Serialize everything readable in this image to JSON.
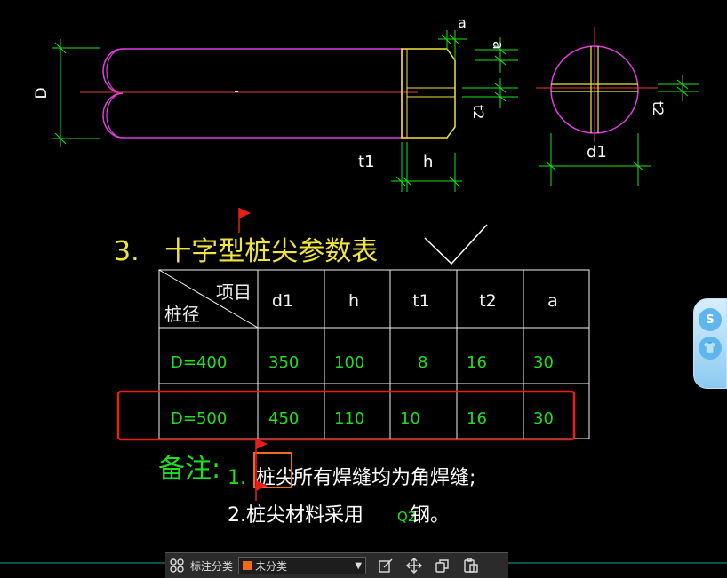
{
  "dimension_labels": {
    "D": "D",
    "a_top": "a",
    "a_side": "a",
    "t2_left": "t2",
    "t1": "t1",
    "h": "h",
    "d1": "d1",
    "t2_right": "t2"
  },
  "table_title": "3.   十字型桩尖参数表",
  "table": {
    "corner_top": "项目",
    "corner_bottom": "桩径",
    "headers": [
      "d1",
      "h",
      "t1",
      "t2",
      "a"
    ],
    "rows": [
      [
        "D=400",
        "350",
        "100",
        "8",
        "16",
        "30"
      ],
      [
        "D=500",
        "450",
        "110",
        "10",
        "16",
        "30"
      ]
    ]
  },
  "notes": {
    "label": "备注:",
    "n1_num": "1.",
    "n1_hl": "桩尖",
    "n1_rest": "所有焊缝均为角焊缝;",
    "n2": "2.桩尖材料采用",
    "n2_q": "Q2",
    "n2_end": "钢。"
  },
  "statusbar": {
    "label": "标注分类",
    "selected": "未分类",
    "swatch_color": "#f06a1a"
  },
  "side_widget": {
    "top": "S",
    "bottom": "👕"
  },
  "colors": {
    "dim": "#1ee01e",
    "magenta": "#e03ce0",
    "yellow": "#f0e53c",
    "center": "#e53c3c",
    "highlight_box": "#e81e1e",
    "white": "#f2f2f2"
  }
}
